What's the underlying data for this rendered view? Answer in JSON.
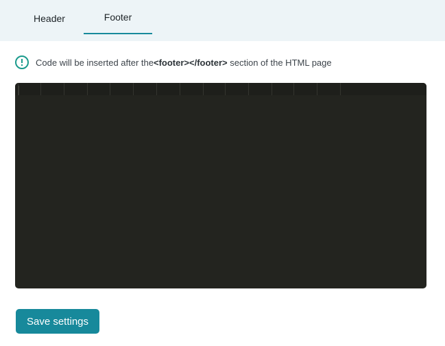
{
  "tabs": [
    {
      "label": "Header",
      "active": false
    },
    {
      "label": "Footer",
      "active": true
    }
  ],
  "notice": {
    "icon": "info-circle-icon",
    "text_before": "Code will be inserted after the ",
    "code_tag": "<footer></footer>",
    "text_after": " section of the HTML page"
  },
  "editor": {
    "content": "",
    "background": "#23241f"
  },
  "actions": {
    "save_label": "Save settings"
  },
  "colors": {
    "accent": "#17899b",
    "tabbar_bg": "#edf4f7",
    "notice_icon": "#1a9a8c"
  }
}
